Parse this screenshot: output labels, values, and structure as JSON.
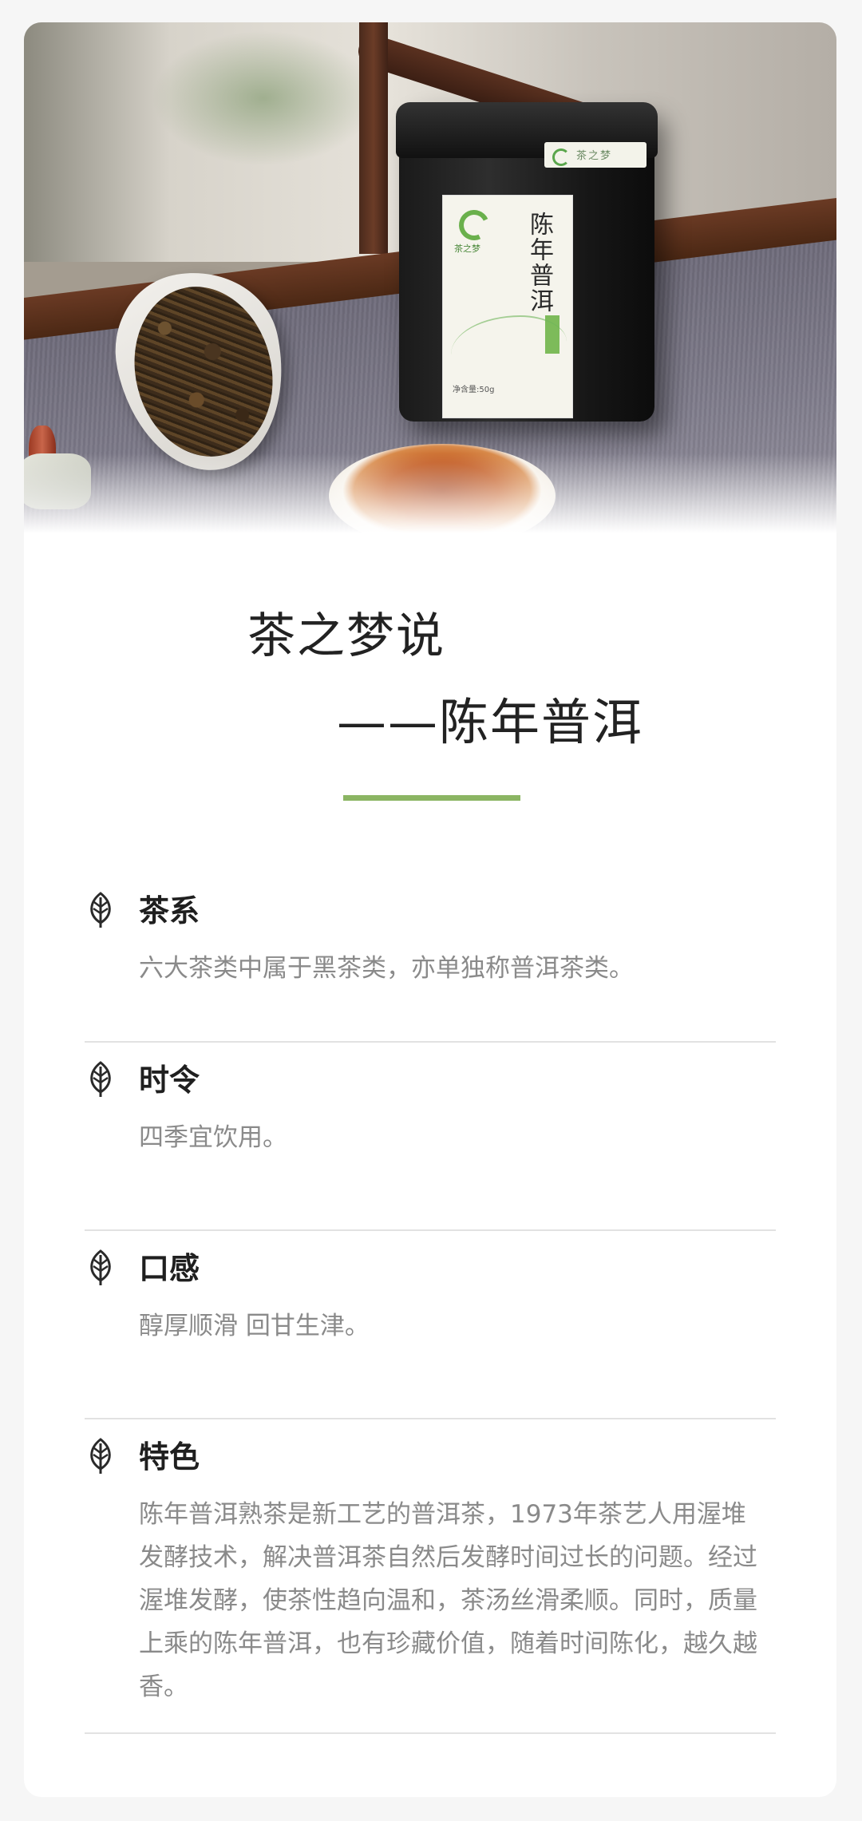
{
  "hero": {
    "tin_label_title": "陈年普洱",
    "tin_label_brand": "茶之梦",
    "tin_label_net": "净含量:50g",
    "tin_side_label": "茶之梦"
  },
  "title": {
    "line1": "茶之梦说",
    "line2": "——陈年普洱"
  },
  "colors": {
    "accent": "#8bb563",
    "text_dark": "#1f1f1f",
    "text_muted": "#8a8a8a",
    "divider": "#e2e2e2"
  },
  "sections": [
    {
      "icon": "leaf-icon",
      "heading": "茶系",
      "text": "六大茶类中属于黑茶类，亦单独称普洱茶类。"
    },
    {
      "icon": "leaf-icon",
      "heading": "时令",
      "text": "四季宜饮用。"
    },
    {
      "icon": "leaf-icon",
      "heading": "口感",
      "text": "醇厚顺滑 回甘生津。"
    },
    {
      "icon": "leaf-icon",
      "heading": "特色",
      "text": "陈年普洱熟茶是新工艺的普洱茶，1973年茶艺人用渥堆发酵技术，解决普洱茶自然后发酵时间过长的问题。经过渥堆发酵，使茶性趋向温和，茶汤丝滑柔顺。同时，质量上乘的陈年普洱，也有珍藏价值，随着时间陈化，越久越香。"
    }
  ]
}
